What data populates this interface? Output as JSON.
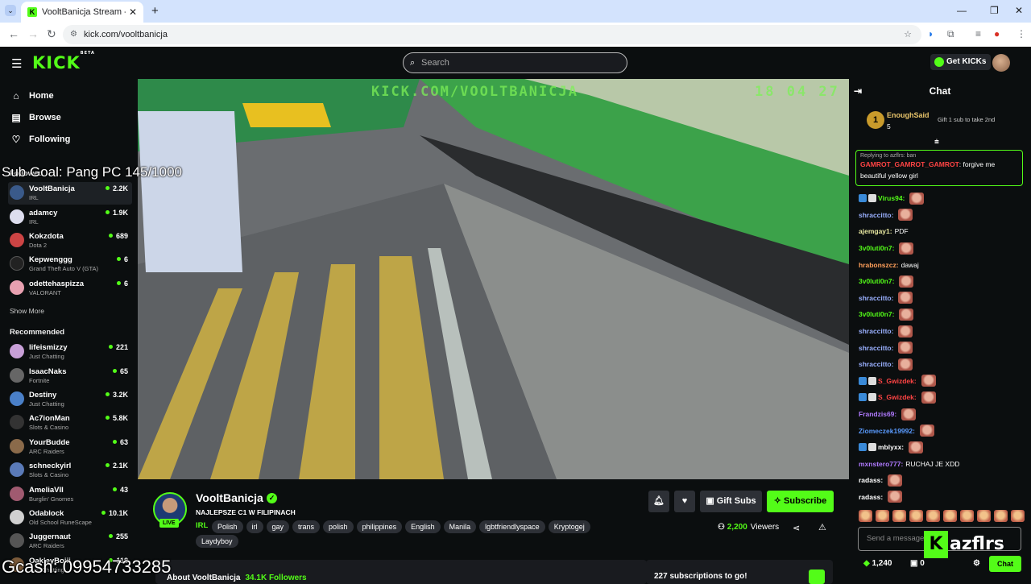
{
  "browser": {
    "tab_title": "VooltBanicja Stream - Watch",
    "url": "kick.com/vooltbanicja"
  },
  "header": {
    "logo": "KICK",
    "beta": "BETA",
    "search_placeholder": "Search",
    "get_kicks": "Get KICKs"
  },
  "sidebar": {
    "nav": [
      {
        "label": "Home",
        "icon": "home-icon"
      },
      {
        "label": "Browse",
        "icon": "browse-icon"
      },
      {
        "label": "Following",
        "icon": "heart-icon"
      }
    ],
    "followed_heading": "Followed",
    "followed": [
      {
        "name": "VooltBanicja",
        "category": "IRL",
        "viewers": "2.2K"
      },
      {
        "name": "adamcy",
        "category": "IRL",
        "viewers": "1.9K"
      },
      {
        "name": "Kokzdota",
        "category": "Dota 2",
        "viewers": "689"
      },
      {
        "name": "Kepwenggg",
        "category": "Grand Theft Auto V (GTA)",
        "viewers": "6"
      },
      {
        "name": "odettehaspizza",
        "category": "VALORANT",
        "viewers": "6"
      }
    ],
    "show_more": "Show More",
    "recommended_heading": "Recommended",
    "recommended": [
      {
        "name": "lifeismizzy",
        "category": "Just Chatting",
        "viewers": "221"
      },
      {
        "name": "IsaacNaks",
        "category": "Fortnite",
        "viewers": "65"
      },
      {
        "name": "Destiny",
        "category": "Just Chatting",
        "viewers": "3.2K"
      },
      {
        "name": "Ac7ionMan",
        "category": "Slots & Casino",
        "viewers": "5.8K"
      },
      {
        "name": "YourBudde",
        "category": "ARC Raiders",
        "viewers": "63"
      },
      {
        "name": "schneckyirl",
        "category": "Slots & Casino",
        "viewers": "2.1K"
      },
      {
        "name": "AmeliaVII",
        "category": "Burglin' Gnomes",
        "viewers": "43"
      },
      {
        "name": "Odablock",
        "category": "Old School RuneScape",
        "viewers": "10.1K"
      },
      {
        "name": "Juggernaut",
        "category": "ARC Raiders",
        "viewers": "255"
      },
      {
        "name": "OakleyBoiii",
        "category": "Just Chatting",
        "viewers": "118"
      }
    ]
  },
  "video": {
    "watermark": "KICK.COM/VOOLTBANICJA",
    "clock": "18 04 27"
  },
  "overlay": {
    "sub_goal": "Sub Goal: Pang PC 145/1000",
    "gcash": "Gcash: 09954733285"
  },
  "streamer": {
    "name": "VooltBanicja",
    "title": "NAJLEPSZE C1 W FILIPINACH",
    "category": "IRL",
    "live": "LIVE",
    "tags": [
      "Polish",
      "irl",
      "gay",
      "trans",
      "polish",
      "philippines",
      "English",
      "Manila",
      "lgbtfriendlyspace",
      "Kryptogej"
    ],
    "tag_extra": "Laydyboy",
    "gift_subs": "Gift Subs",
    "subscribe": "Subscribe",
    "viewers_count": "2,200",
    "viewers_label": "Viewers",
    "about": "About VooltBanicja",
    "followers": "34.1K Followers",
    "subs_goal": "227 subscriptions to go!"
  },
  "chat": {
    "title": "Chat",
    "top_gifter": {
      "rank": "1",
      "name": "EnoughSaid",
      "count": "5"
    },
    "gift_hint": "Gift 1 sub to take 2nd",
    "reply_to": "Replying to azflrs: ban",
    "reply_user": "GAMROT_GAMROT_GAMROT",
    "reply_text": ": forgive me beautiful yellow girl",
    "messages": [
      {
        "user": "Virus94",
        "color": "#53fc18",
        "text": "",
        "emote": true,
        "badges": true
      },
      {
        "user": "shraccitto",
        "color": "#9ab0ff",
        "text": "",
        "emote": true
      },
      {
        "user": "ajemgay1",
        "color": "#e8e8a0",
        "text": "PDF",
        "emote": false
      },
      {
        "user": "3v0luti0n7",
        "color": "#53fc18",
        "text": "",
        "emote": true
      },
      {
        "user": "hrabonszcz",
        "color": "#ff9f5a",
        "text": "dawaj",
        "emote": false
      },
      {
        "user": "3v0luti0n7",
        "color": "#53fc18",
        "text": "",
        "emote": true
      },
      {
        "user": "shraccitto",
        "color": "#9ab0ff",
        "text": "",
        "emote": true
      },
      {
        "user": "3v0luti0n7",
        "color": "#53fc18",
        "text": "",
        "emote": true
      },
      {
        "user": "shraccitto",
        "color": "#9ab0ff",
        "text": "",
        "emote": true
      },
      {
        "user": "shraccitto",
        "color": "#9ab0ff",
        "text": "",
        "emote": true
      },
      {
        "user": "shraccitto",
        "color": "#9ab0ff",
        "text": "",
        "emote": true
      },
      {
        "user": "S_Gwizdek",
        "color": "#ff4444",
        "text": "",
        "emote": true,
        "badges": true
      },
      {
        "user": "S_Gwizdek",
        "color": "#ff4444",
        "text": "",
        "emote": true,
        "badges": true
      },
      {
        "user": "Frandzis69",
        "color": "#b07aff",
        "text": "",
        "emote": true
      },
      {
        "user": "Ziomeczek19992",
        "color": "#5a9bff",
        "text": "",
        "emote": true
      },
      {
        "user": "mblyxx",
        "color": "#fff",
        "text": "",
        "emote": true,
        "badges": true
      },
      {
        "user": "mxnstero777",
        "color": "#b07aff",
        "text": "RUCHAJ JE XDD",
        "emote": false
      },
      {
        "user": "radass",
        "color": "#fff",
        "text": "",
        "emote": true
      },
      {
        "user": "radass",
        "color": "#fff",
        "text": "",
        "emote": true
      }
    ],
    "input_placeholder": "Send a message",
    "brand_overlay": "azflrs",
    "points": "1,240",
    "gifts": "0",
    "chat_button": "Chat"
  },
  "colors": {
    "accent": "#53fc18",
    "background": "#0b0e0f",
    "panel": "#191b1f"
  }
}
